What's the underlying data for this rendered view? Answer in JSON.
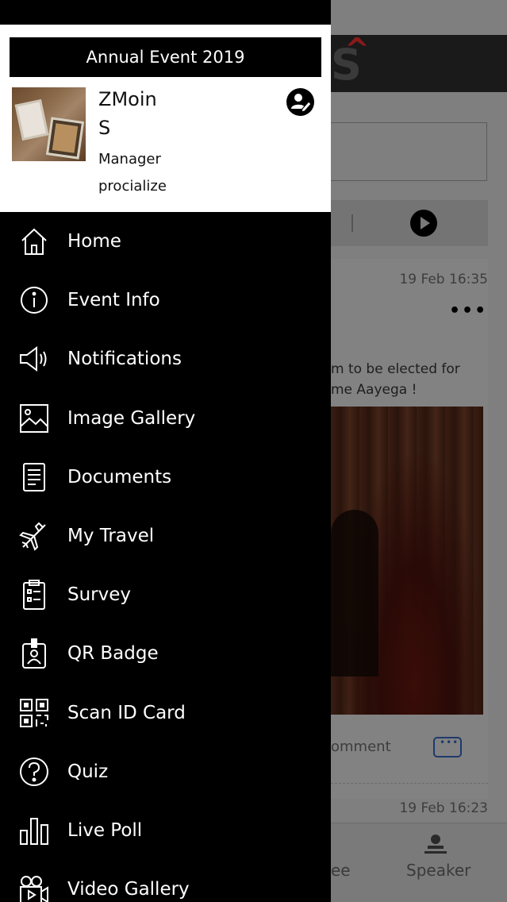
{
  "drawer": {
    "event_title": "Annual Event 2019",
    "user": {
      "name": "ZMoin\nS",
      "role": "Manager",
      "organization": "procialize"
    },
    "menu": [
      {
        "label": "Home",
        "icon": "home-icon"
      },
      {
        "label": "Event Info",
        "icon": "info-icon"
      },
      {
        "label": "Notifications",
        "icon": "megaphone-icon"
      },
      {
        "label": "Image Gallery",
        "icon": "image-icon"
      },
      {
        "label": "Documents",
        "icon": "document-icon"
      },
      {
        "label": "My Travel",
        "icon": "airplane-icon"
      },
      {
        "label": "Survey",
        "icon": "clipboard-icon"
      },
      {
        "label": "QR Badge",
        "icon": "badge-icon"
      },
      {
        "label": "Scan ID Card",
        "icon": "qr-code-icon"
      },
      {
        "label": "Quiz",
        "icon": "question-icon"
      },
      {
        "label": "Live Poll",
        "icon": "bar-chart-icon"
      },
      {
        "label": "Video Gallery",
        "icon": "video-camera-icon"
      }
    ]
  },
  "background": {
    "post1_time": "19 Feb 16:35",
    "post1_text_line1": "m to be elected for",
    "post1_text_line2": "me Aayega !",
    "comment_label": "omment",
    "post2_time": "19 Feb 16:23",
    "tab_partial": "ee",
    "tab_speaker": "Speaker"
  },
  "colors": {
    "drawer_bg": "#000000",
    "profile_bg": "#ffffff",
    "overlay": "#7f7f7f",
    "comment_icon": "#1e3a6b"
  }
}
